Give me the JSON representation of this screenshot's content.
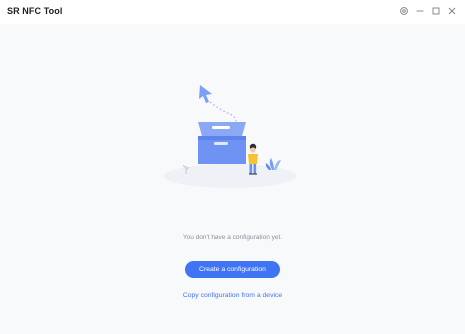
{
  "window": {
    "title": "SR NFC Tool",
    "controls": [
      "settings-icon",
      "minimize-icon",
      "maximize-icon",
      "close-icon"
    ]
  },
  "empty_state": {
    "message": "You don't have a configuration yet.",
    "primary_action": "Create a configuration",
    "secondary_action": "Copy configuration from a device"
  },
  "colors": {
    "accent": "#3f74f5",
    "background": "#f8f9fb",
    "text_muted": "#8a8f99"
  }
}
